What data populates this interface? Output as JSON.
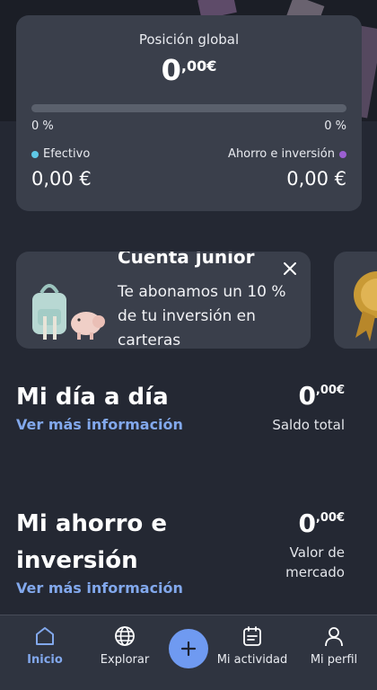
{
  "global": {
    "title": "Posición global",
    "amount_int": "0",
    "amount_dec": ",00",
    "amount_cur": "€",
    "progress": 0,
    "pct_left": "0 %",
    "pct_right": "0 %",
    "cash_label": "Efectivo",
    "cash_value": "0,00 €",
    "savings_label": "Ahorro e inversión",
    "savings_value": "0,00 €",
    "cash_color": "#5fc8e6",
    "savings_color": "#9b5fd1"
  },
  "promo": {
    "title": "Cuenta junior",
    "text": "Te abonamos un 10 % de tu inversión en carteras"
  },
  "sections": [
    {
      "title": "Mi día a día",
      "link": "Ver más información",
      "amount_int": "0",
      "amount_dec": ",00",
      "amount_cur": "€",
      "subtitle": "Saldo total"
    },
    {
      "title_line1": "Mi ahorro e",
      "title_line2": "inversión",
      "link": "Ver más información",
      "amount_int": "0",
      "amount_dec": ",00",
      "amount_cur": "€",
      "subtitle_line1": "Valor de",
      "subtitle_line2": "mercado"
    }
  ],
  "nav": [
    {
      "label": "Inicio",
      "icon": "home-icon",
      "active": true
    },
    {
      "label": "Explorar",
      "icon": "globe-icon"
    },
    {
      "label": "",
      "icon": "plus-icon"
    },
    {
      "label": "Mi actividad",
      "icon": "activity-icon"
    },
    {
      "label": "Mi perfil",
      "icon": "user-icon"
    }
  ],
  "colors": {
    "accent": "#82a8ec",
    "fab": "#6f9af1",
    "card": "#3a3f4b",
    "background": "#242833"
  }
}
